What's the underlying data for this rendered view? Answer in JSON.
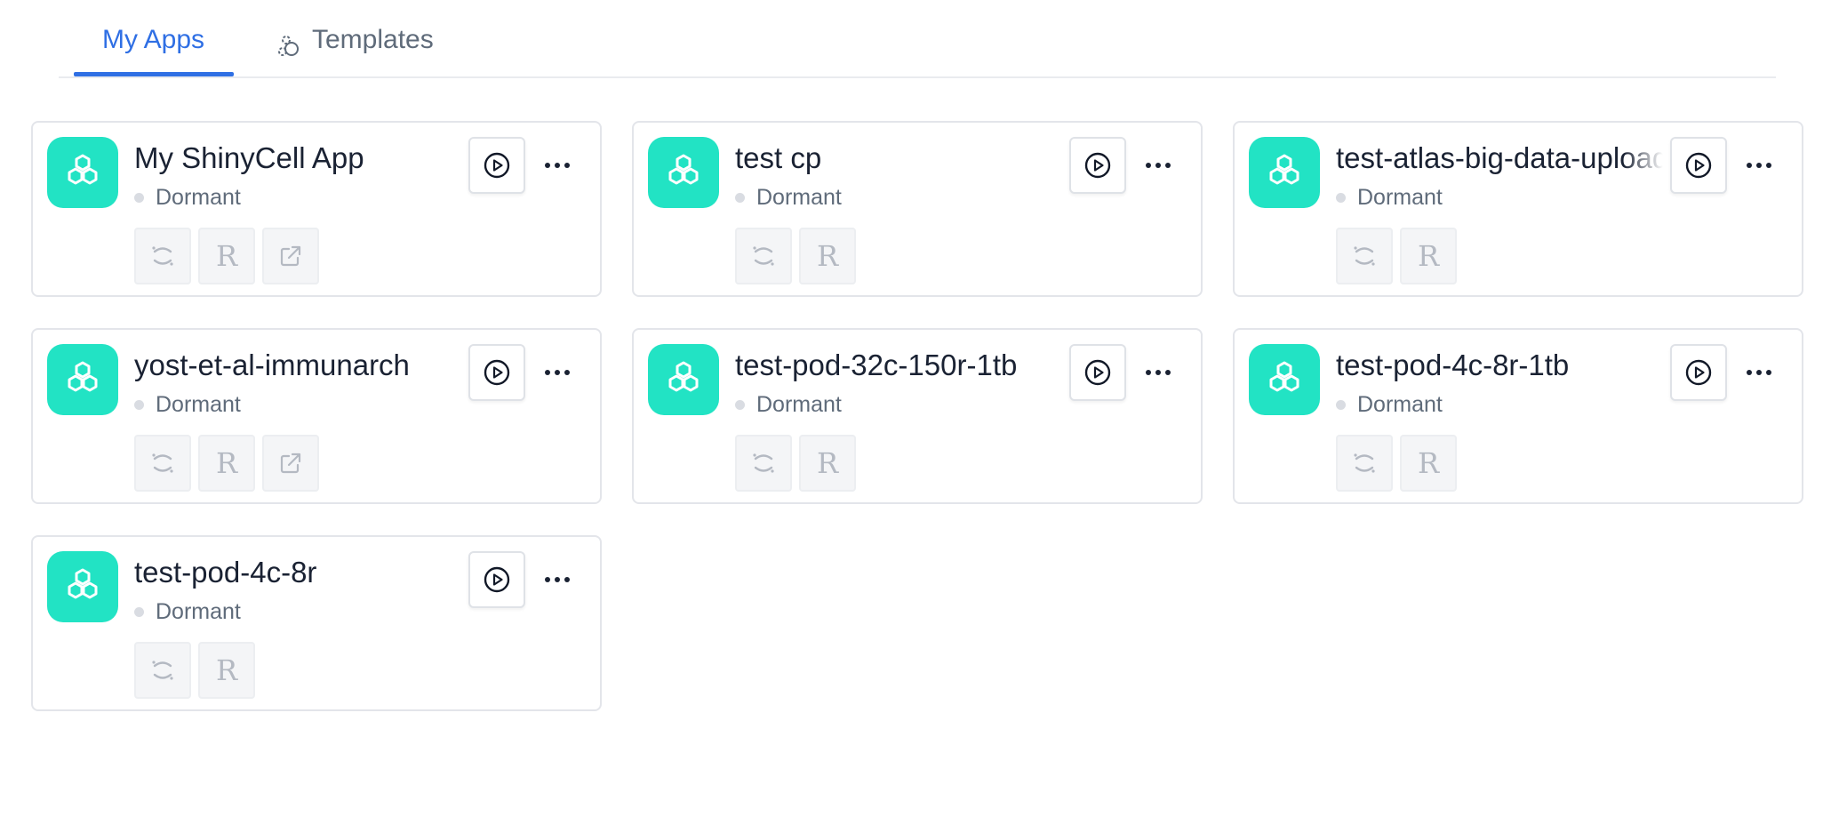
{
  "tabs": [
    {
      "label": "My Apps",
      "active": true
    },
    {
      "label": "Templates",
      "active": false
    }
  ],
  "colors": {
    "accent": "#2f6fe4",
    "app_icon_bg": "#22e3c4",
    "status_dormant": "#d9dce2"
  },
  "apps": [
    {
      "name": "My ShinyCell App",
      "status": "Dormant",
      "tools": [
        "spinner-icon",
        "r-language-icon",
        "external-link-icon"
      ]
    },
    {
      "name": "test cp",
      "status": "Dormant",
      "tools": [
        "spinner-icon",
        "r-language-icon"
      ]
    },
    {
      "name": "test-atlas-big-data-upload",
      "status": "Dormant",
      "tools": [
        "spinner-icon",
        "r-language-icon"
      ]
    },
    {
      "name": "yost-et-al-immunarch",
      "status": "Dormant",
      "tools": [
        "spinner-icon",
        "r-language-icon",
        "external-link-icon"
      ]
    },
    {
      "name": "test-pod-32c-150r-1tb",
      "status": "Dormant",
      "tools": [
        "spinner-icon",
        "r-language-icon"
      ]
    },
    {
      "name": "test-pod-4c-8r-1tb",
      "status": "Dormant",
      "tools": [
        "spinner-icon",
        "r-language-icon"
      ]
    },
    {
      "name": "test-pod-4c-8r",
      "status": "Dormant",
      "tools": [
        "spinner-icon",
        "r-language-icon"
      ]
    }
  ],
  "tool_labels": {
    "r": "R"
  }
}
